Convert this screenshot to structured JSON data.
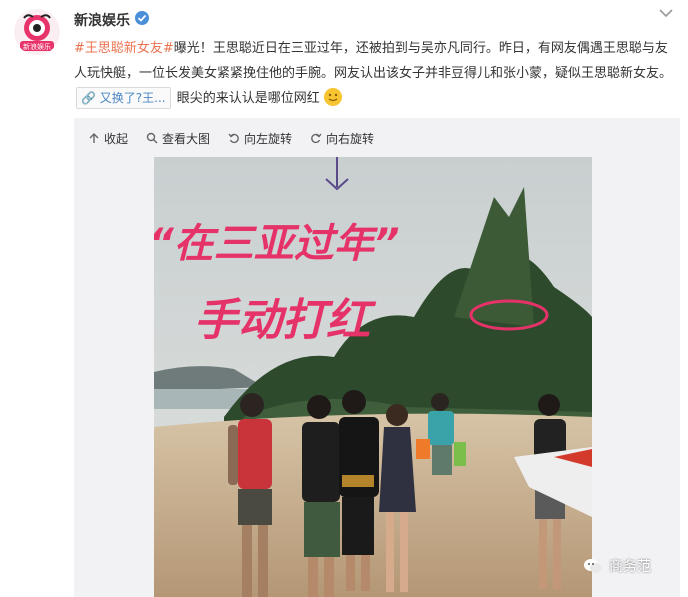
{
  "account": {
    "name": "新浪娱乐",
    "avatar_text": "新浪娱乐",
    "verified": true
  },
  "post": {
    "tag": "#王思聪新女友#",
    "text_a": "曝光！",
    "text_highlight_1": "王思聪近日",
    "text_b": "在",
    "text_highlight_2": "三亚过年",
    "text_c": "，还被拍到与吴亦凡同行。昨日，有网友偶遇王思聪与友人玩快艇，一位长发美女紧紧挽住他的手腕。网友认出该女子并非豆得儿和张小蒙，疑似王思聪新女友。",
    "link_chip": "又换了?王...",
    "text_d": " 眼尖的来认认是哪位网红",
    "emoji": "smile-emoji"
  },
  "media_toolbar": {
    "collapse": "收起",
    "view_large": "查看大图",
    "rotate_left": "向左旋转",
    "rotate_right": "向右旋转"
  },
  "photo_annotation": {
    "line1": "“在三亚过年”",
    "line2": "手动打红"
  },
  "watermark": {
    "text": "商务范"
  },
  "colors": {
    "tag": "#eb7350",
    "link": "#4a86c5",
    "annotation": "#e5336a"
  }
}
